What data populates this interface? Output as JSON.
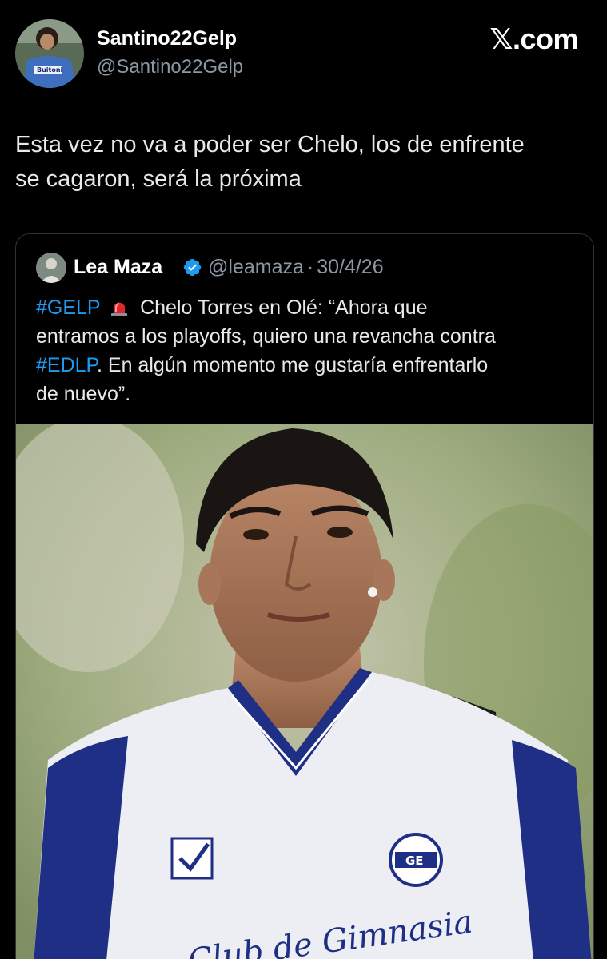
{
  "author": {
    "name": "Santino22Gelp",
    "handle": "@Santino22Gelp"
  },
  "brand": {
    "x_glyph": "𝕏",
    "suffix": ".com"
  },
  "tweet": {
    "line1": "Esta vez no va a poder ser Chelo, los de enfrente",
    "line2": "se cagaron, será la próxima"
  },
  "quote": {
    "name": "Lea Maza",
    "handle": "@leamaza",
    "separator": "·",
    "date": "30/4/26",
    "hashtag1": "#GELP",
    "text_part1": "Chelo Torres en Olé: “Ahora que",
    "text_line2": "entramos a los playoffs, quiero una revancha contra",
    "hashtag2": "#EDLP",
    "text_part3": ". En algún momento me gustaría enfrentarlo",
    "text_line4": "de nuevo”."
  },
  "photo": {
    "jersey_text": "Club de Gimnasia",
    "badge_text": "GE"
  },
  "colors": {
    "background": "#000000",
    "text": "#e7e9ea",
    "muted": "#8b98a5",
    "link": "#1d9bf0",
    "verified": "#1d9bf0",
    "jersey_blue": "#1f2f86"
  }
}
